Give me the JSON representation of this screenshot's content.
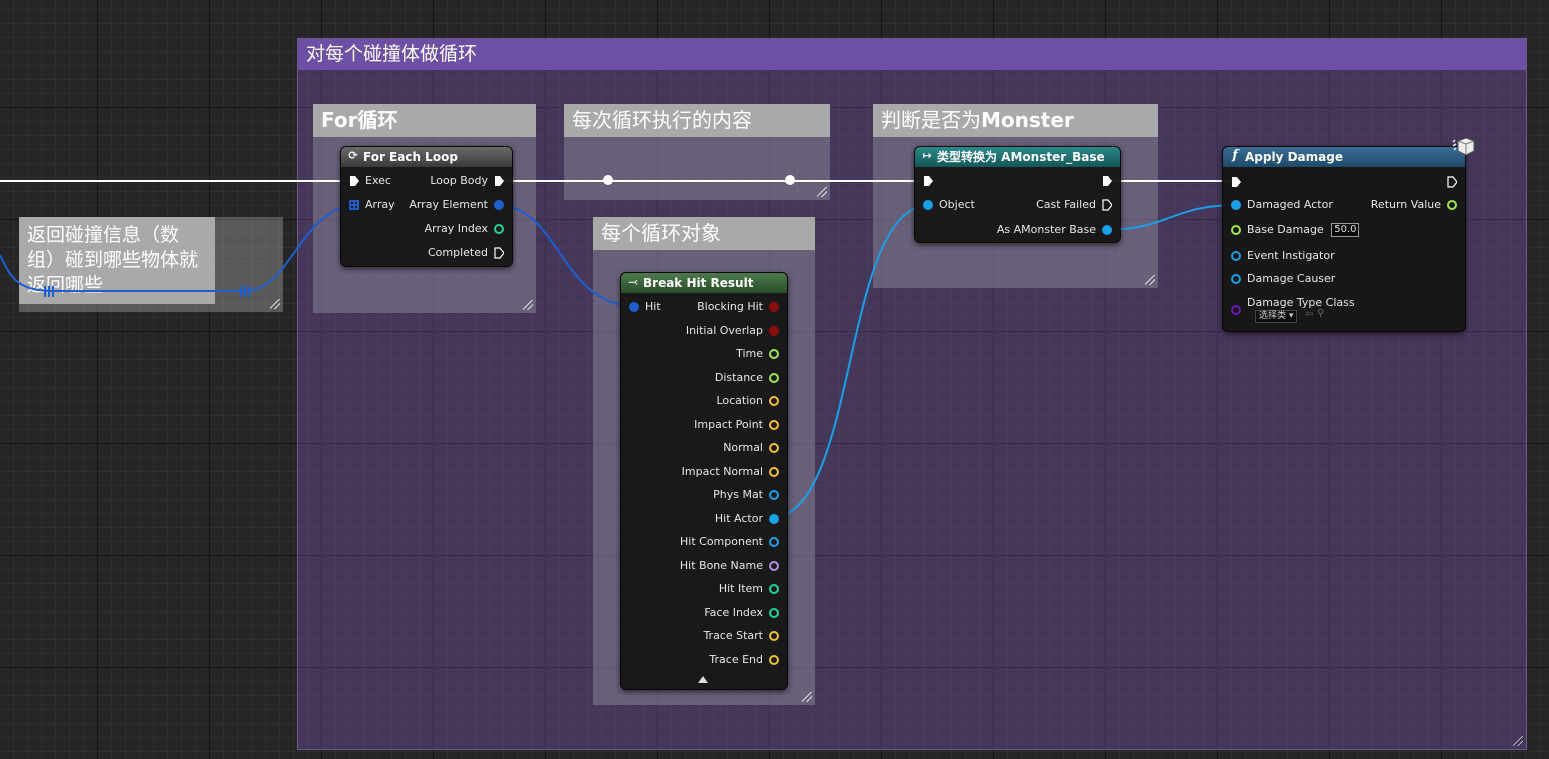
{
  "outer_comment": {
    "title": "对每个碰撞体做循环"
  },
  "comments": {
    "left_note": {
      "text": "返回碰撞信息（数组）碰到哪些物体就返回哪些"
    },
    "for_loop": {
      "title": "For循环"
    },
    "loop_body": {
      "title": "每次循环执行的内容"
    },
    "loop_object": {
      "title": "每个循环对象"
    },
    "is_monster": {
      "title_prefix": "判断是否为",
      "title_bold": "Monster"
    }
  },
  "nodes": {
    "for_each_loop": {
      "title": "For Each Loop",
      "header_color": "#4a4a4a",
      "inputs": [
        "Exec",
        "Array"
      ],
      "outputs": [
        "Loop Body",
        "Array Element",
        "Array Index",
        "Completed"
      ]
    },
    "cast": {
      "title": "类型转换为 AMonster_Base",
      "header_color": "#1b6a6a",
      "inputs": [
        "Object"
      ],
      "outputs": [
        "Cast Failed",
        "As AMonster Base"
      ]
    },
    "break_hit": {
      "title": "Break Hit Result",
      "header_color": "#3c6a3c",
      "input": "Hit",
      "outputs": [
        "Blocking Hit",
        "Initial Overlap",
        "Time",
        "Distance",
        "Location",
        "Impact Point",
        "Normal",
        "Impact Normal",
        "Phys Mat",
        "Hit Actor",
        "Hit Component",
        "Hit Bone Name",
        "Hit Item",
        "Face Index",
        "Trace Start",
        "Trace End"
      ]
    },
    "apply_damage": {
      "title": "Apply Damage",
      "header_color": "#2a5a7a",
      "inputs": [
        "Damaged Actor",
        "Base Damage",
        "Event Instigator",
        "Damage Causer",
        "Damage Type Class"
      ],
      "base_damage_value": "50.0",
      "damage_type_select": "选择类",
      "outputs": [
        "Return Value"
      ]
    }
  },
  "colors": {
    "exec": "#ffffff",
    "object": "#1aa0e8",
    "struct": "#1e5fd0",
    "int": "#1fd49a",
    "float": "#9eea4a",
    "vector": "#f4c030",
    "bool": "#8b0e0e",
    "name": "#b98be8",
    "class": "#6a1ab0",
    "comment_purple": "#6d4fa6"
  },
  "icons": {
    "for_each": "loop-icon",
    "cast": "cast-arrow-icon",
    "break": "break-struct-icon",
    "function": "function-icon",
    "network": "cube-icon"
  }
}
